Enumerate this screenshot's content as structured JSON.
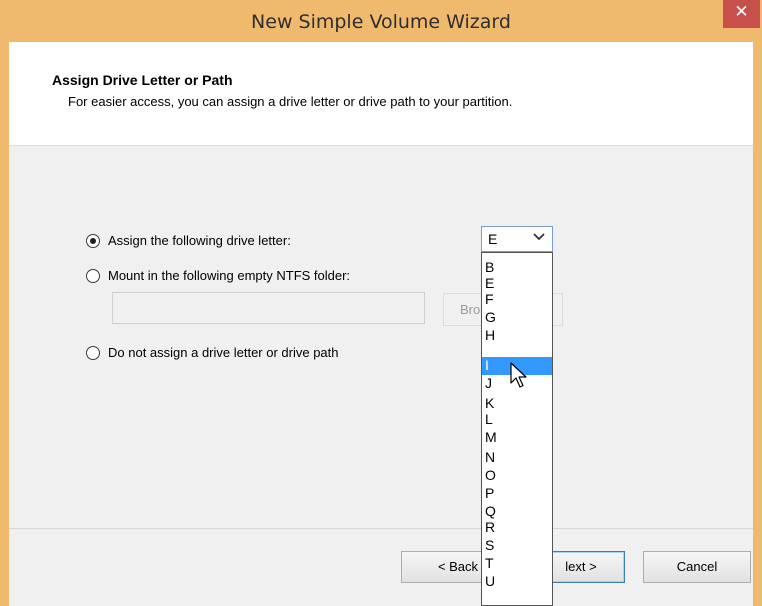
{
  "window": {
    "title": "New Simple Volume Wizard",
    "close_label": "✕"
  },
  "header": {
    "title": "Assign Drive Letter or Path",
    "subtitle": "For easier access, you can assign a drive letter or drive path to your partition."
  },
  "options": {
    "assign_letter": {
      "label": "Assign the following drive letter:",
      "checked": true
    },
    "mount_folder": {
      "label": "Mount in the following empty NTFS folder:",
      "checked": false,
      "browse_label": "Bro"
    },
    "no_assign": {
      "label": "Do not assign a drive letter or drive path",
      "checked": false
    }
  },
  "combo": {
    "value": "E",
    "arrow_icon": "chevron-down-icon"
  },
  "dropdown": {
    "items": [
      "B",
      "E",
      "F",
      "G",
      "H",
      "I",
      "J",
      "K",
      "L",
      "M",
      "N",
      "O",
      "P",
      "Q",
      "R",
      "S",
      "T",
      "U"
    ],
    "selected": "I"
  },
  "buttons": {
    "back": "< Back",
    "next": "lext >",
    "cancel": "Cancel"
  },
  "colors": {
    "titlebar": "#f0ba6e",
    "close": "#c7504b",
    "selection": "#3399ff"
  }
}
